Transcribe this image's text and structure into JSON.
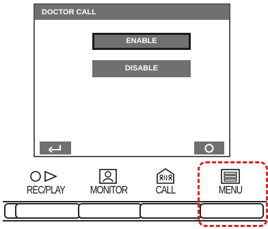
{
  "screen": {
    "title": "DOCTOR CALL",
    "options": [
      "ENABLE",
      "DISABLE"
    ]
  },
  "hardware": {
    "rec_play": "REC/PLAY",
    "monitor": "MONITOR",
    "call": "CALL",
    "menu": "MENU"
  },
  "colors": {
    "panel_gray": "#707070",
    "highlight_red": "#e01a1a"
  }
}
